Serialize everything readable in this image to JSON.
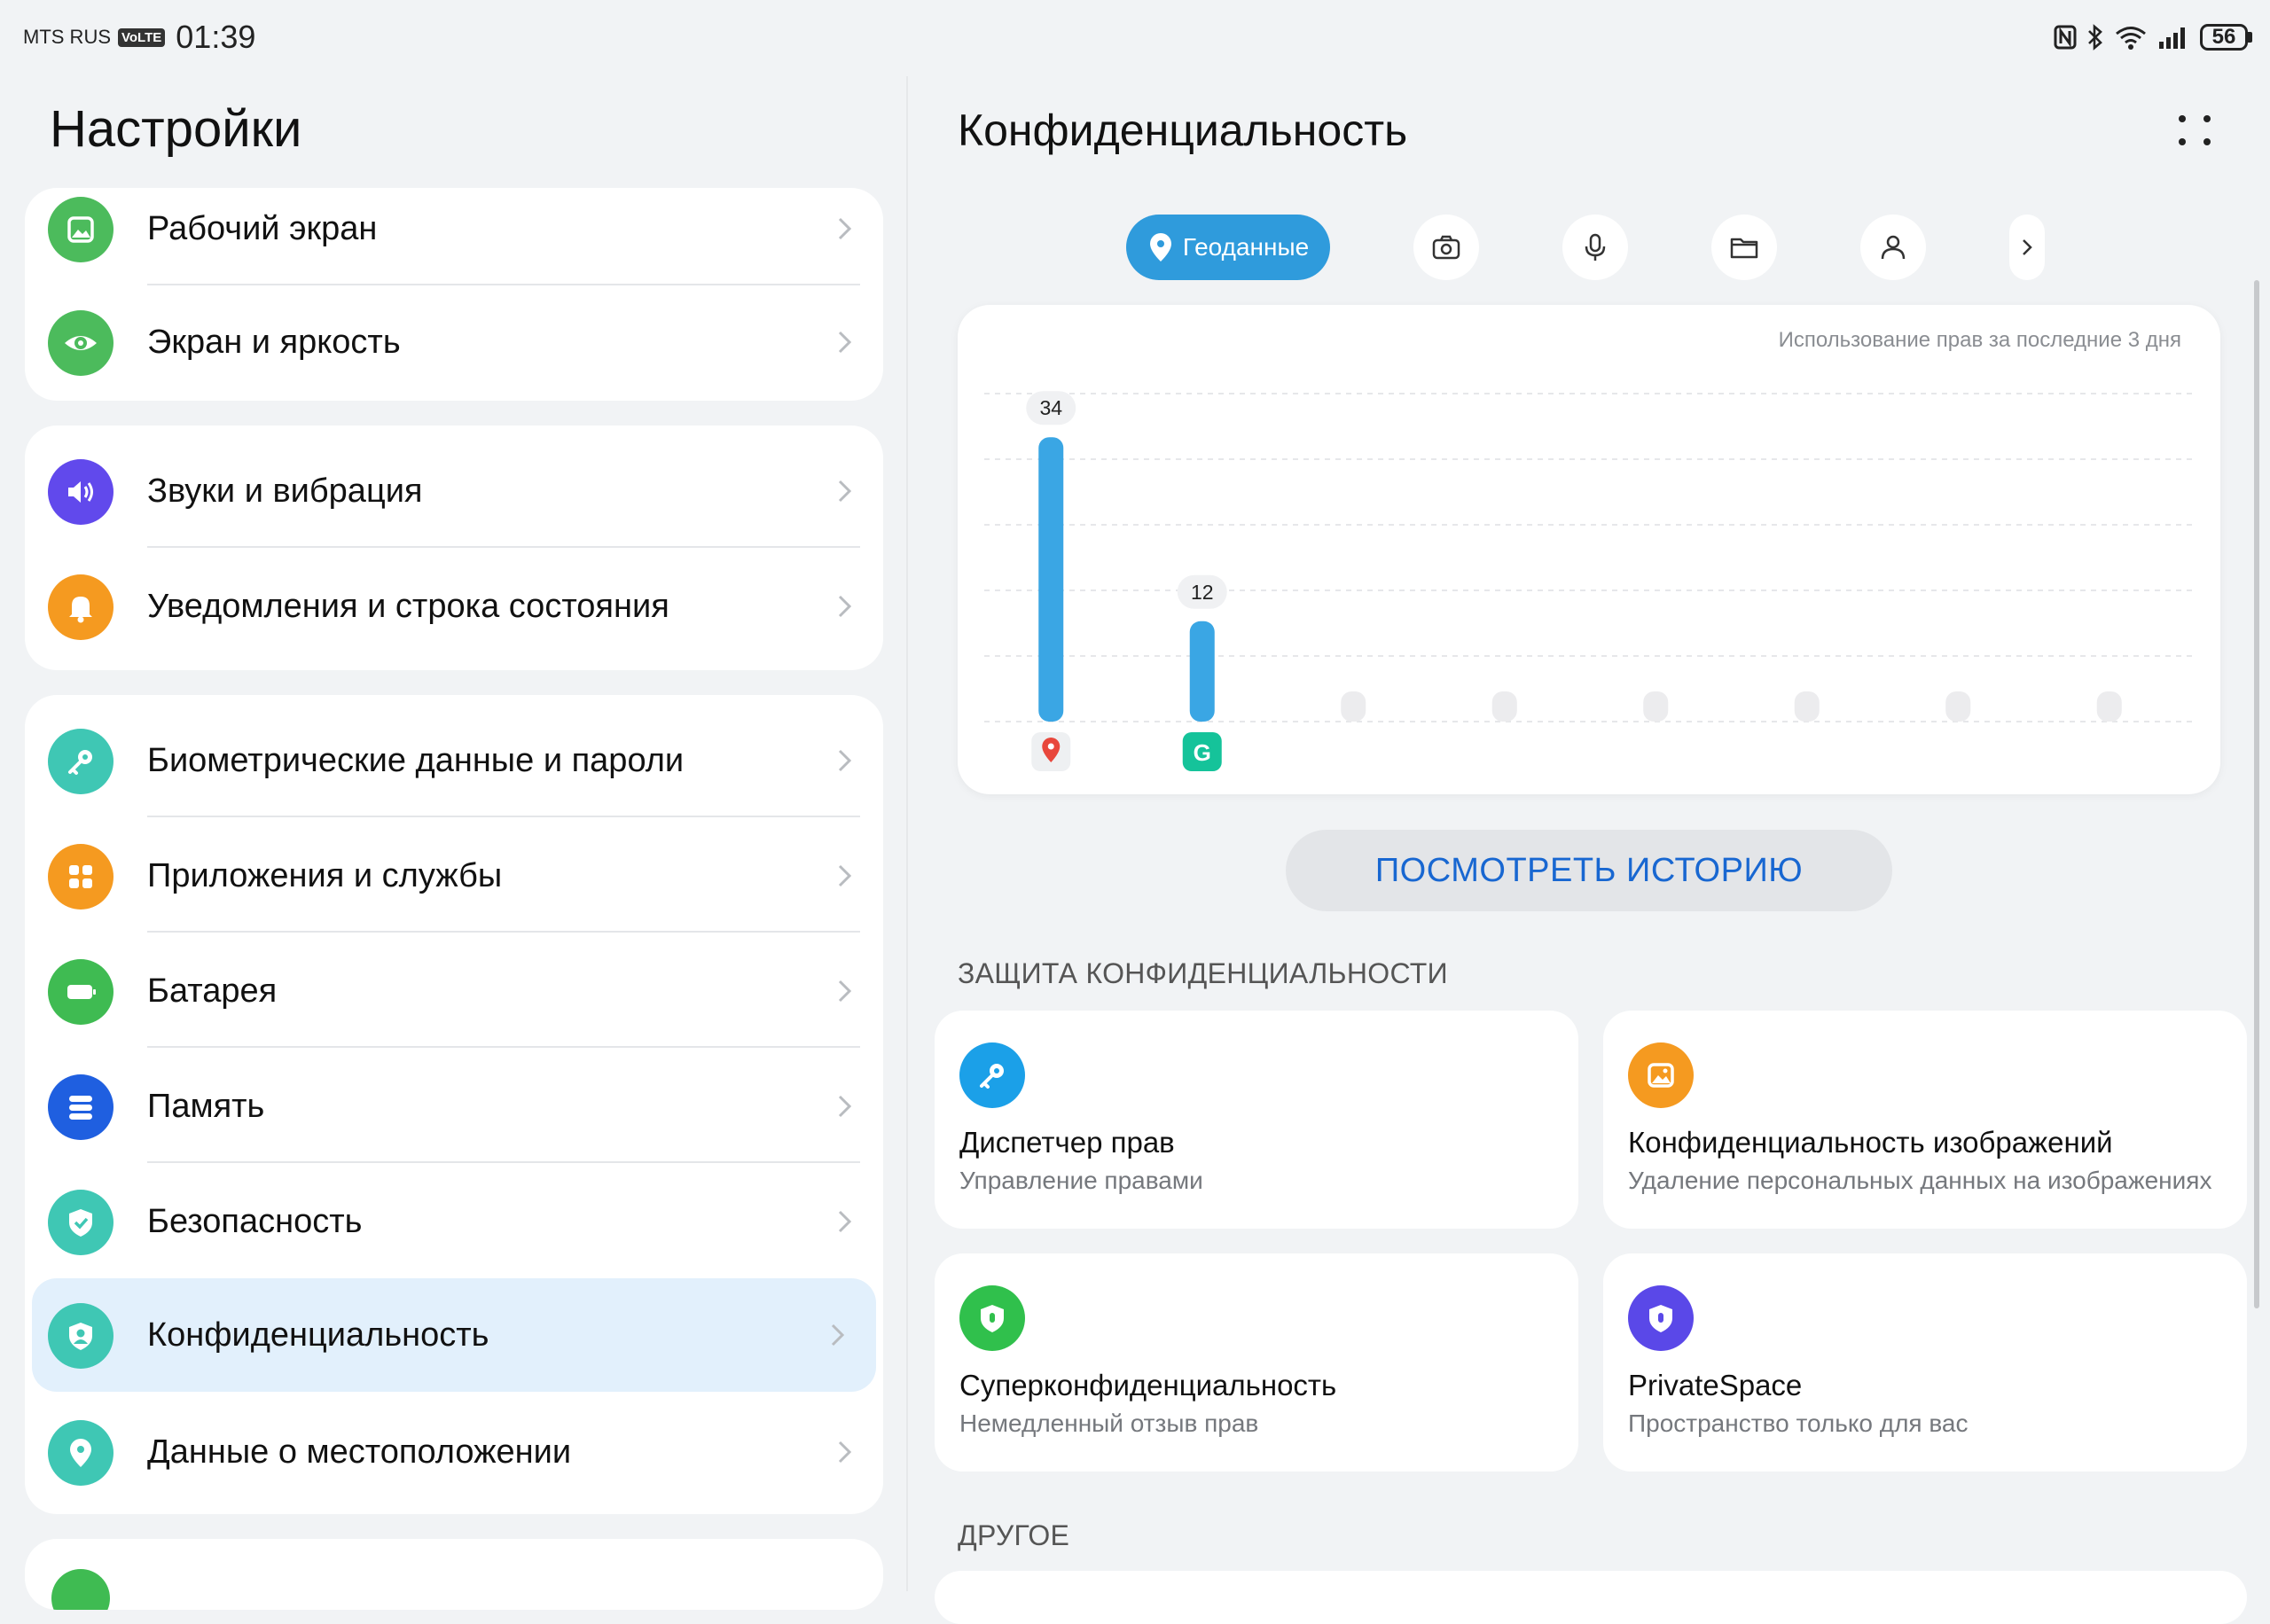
{
  "status_bar": {
    "carrier": "MTS RUS",
    "volte": "VoLTE",
    "time": "01:39",
    "battery": "56",
    "icons": [
      "nfc-icon",
      "bluetooth-icon",
      "wifi-icon",
      "signal-icon",
      "battery-icon"
    ]
  },
  "settings": {
    "title": "Настройки",
    "groups": [
      {
        "items": [
          {
            "label": "Рабочий экран",
            "icon": "home-screen-icon",
            "color": "#4cbb5c"
          },
          {
            "label": "Экран и яркость",
            "icon": "eye-icon",
            "color": "#4cbb5c"
          }
        ]
      },
      {
        "items": [
          {
            "label": "Звуки и вибрация",
            "icon": "speaker-icon",
            "color": "#6149ec"
          },
          {
            "label": "Уведомления и строка состояния",
            "icon": "bell-icon",
            "color": "#f59a20"
          }
        ]
      },
      {
        "items": [
          {
            "label": "Биометрические данные и пароли",
            "icon": "key-icon",
            "color": "#3fc7b4"
          },
          {
            "label": "Приложения и службы",
            "icon": "apps-icon",
            "color": "#f59a20"
          },
          {
            "label": "Батарея",
            "icon": "battery-icon",
            "color": "#3fbb52"
          },
          {
            "label": "Память",
            "icon": "storage-icon",
            "color": "#1f5fe0"
          },
          {
            "label": "Безопасность",
            "icon": "shield-check-icon",
            "color": "#3fc7b4"
          },
          {
            "label": "Конфиденциальность",
            "icon": "privacy-icon",
            "color": "#3fc7b4",
            "selected": true
          },
          {
            "label": "Данные о местоположении",
            "icon": "location-pin-icon",
            "color": "#3fc7b4"
          }
        ]
      }
    ]
  },
  "privacy": {
    "title": "Конфиденциальность",
    "tabs": [
      {
        "label": "Геоданные",
        "icon": "location-pin-icon",
        "active": true
      },
      {
        "icon": "camera-icon"
      },
      {
        "icon": "microphone-icon"
      },
      {
        "icon": "folder-icon"
      },
      {
        "icon": "contacts-icon"
      },
      {
        "icon": "chevron-right-icon"
      }
    ],
    "chart_subtitle": "Использование прав за последние 3 дня",
    "history_button": "ПОСМОТРЕТЬ ИСТОРИЮ",
    "protection_header": "ЗАЩИТА КОНФИДЕНЦИАЛЬНОСТИ",
    "cards": [
      {
        "title": "Диспетчер прав",
        "subtitle": "Управление правами",
        "icon": "key-icon",
        "color": "#1ba0e8"
      },
      {
        "title": "Конфиденциальность изображений",
        "subtitle": "Удаление персональных данных на изображениях",
        "icon": "image-icon",
        "color": "#f59a20"
      },
      {
        "title": "Суперконфиденциальность",
        "subtitle": "Немедленный отзыв прав",
        "icon": "shield-icon",
        "color": "#30c04c"
      },
      {
        "title": "PrivateSpace",
        "subtitle": "Пространство только для вас",
        "icon": "shield-icon",
        "color": "#5a48e8"
      }
    ],
    "other_header": "ДРУГОЕ"
  },
  "chart_data": {
    "type": "bar",
    "title": "Использование прав за последние 3 дня",
    "categories": [
      "maps-app",
      "grammarly-app",
      "",
      "",
      "",
      "",
      "",
      ""
    ],
    "values": [
      34,
      12,
      0,
      0,
      0,
      0,
      0,
      0
    ],
    "data_labels": [
      "34",
      "12",
      "",
      "",
      "",
      "",
      "",
      ""
    ],
    "bar_color": "#3aa6e4",
    "empty_bar_color": "#ececee",
    "grid": true
  }
}
